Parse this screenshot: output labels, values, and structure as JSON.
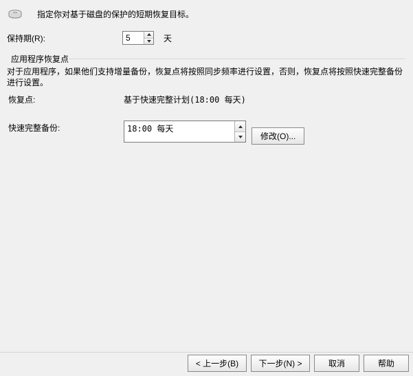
{
  "header": {
    "icon": "disk-icon",
    "title": "指定你对基于磁盘的保护的短期恢复目标。"
  },
  "retention": {
    "label": "保持期(R):",
    "value": "5",
    "unit": "天"
  },
  "app_points": {
    "legend": "应用程序恢复点",
    "description": "对于应用程序，如果他们支持增量备份，恢复点将按照同步频率进行设置，否则，恢复点将按照快速完整备份进行设置。",
    "recovery_point_label": "恢复点:",
    "recovery_point_value": "基于快速完整计划(18:00 每天)",
    "express_backup_label": "快速完整备份:",
    "express_backup_schedule": "18:00 每天",
    "modify_button": "修改(O)..."
  },
  "footer": {
    "back": "< 上一步(B)",
    "next": "下一步(N) >",
    "cancel": "取消",
    "help": "帮助"
  }
}
